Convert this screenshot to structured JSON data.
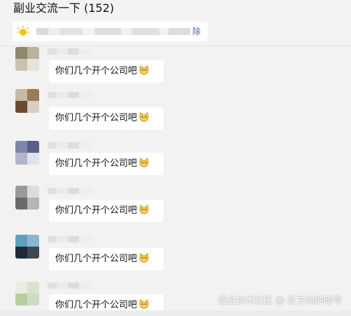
{
  "header": {
    "title": "副业交流一下 (152)"
  },
  "notice": {
    "icon": "sun-icon",
    "remove_label": "除"
  },
  "messages": [
    {
      "text": "你们几个开个公司吧",
      "emoji": "cat-face-icon"
    },
    {
      "text": "你们几个开个公司吧",
      "emoji": "cat-face-icon"
    },
    {
      "text": "你们几个开个公司吧",
      "emoji": "cat-face-icon"
    },
    {
      "text": "你们几个开个公司吧",
      "emoji": "cat-face-icon"
    },
    {
      "text": "你们几个开个公司吧",
      "emoji": "cat-face-icon"
    },
    {
      "text": "你们几个开个公司吧",
      "emoji": "cat-face-icon"
    }
  ],
  "watermark": "掘金技术社区 @ 反方向的暗号",
  "colors": {
    "background": "#f2f2f2",
    "bubble": "#ffffff",
    "link": "#4a6a9a"
  }
}
